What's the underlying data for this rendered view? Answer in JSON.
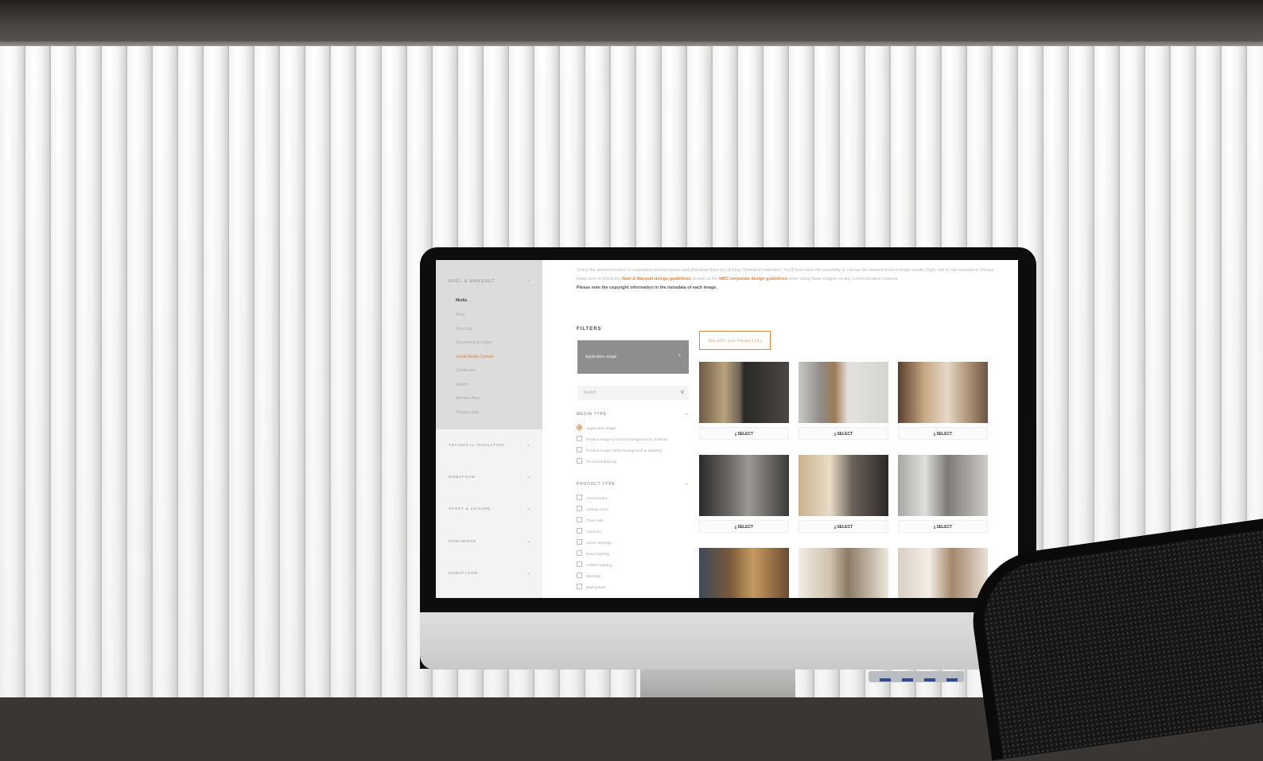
{
  "sidebar": {
    "brand": "NOËL & MARQUET",
    "items": [
      {
        "label": "Media",
        "state": "active"
      },
      {
        "label": "Shop",
        "state": "normal"
      },
      {
        "label": "Price List",
        "state": "normal"
      },
      {
        "label": "Documents & Logos",
        "state": "normal"
      },
      {
        "label": "Social Media Content",
        "state": "highlight"
      },
      {
        "label": "Certificates",
        "state": "normal"
      },
      {
        "label": "Search",
        "state": "normal"
      },
      {
        "label": "Member Area",
        "state": "normal"
      },
      {
        "label": "Private Label",
        "state": "normal"
      }
    ],
    "categories": [
      "TECHNICAL INSULATION",
      "NOMAFOAM",
      "SPORT & LEISURE",
      "NOMAWOOD",
      "NOMAFLOOR"
    ]
  },
  "intro": {
    "line1": "Select the desired product or inspiration pictures below and download them by clicking \"Download selection\". You'll then have the possibility to choose the desired level of image quality (high, mid or low resolution). Please make sure to follow the ",
    "link1": "Noël & Marquet design guidelines",
    "mid": " as well as the ",
    "link2": "NMC corporate design guidelines",
    "line2": " when using these images on any communication material.",
    "note": "Please note the copyright information in the metadata of each image."
  },
  "filters": {
    "title": "FILTERS",
    "active_chip": "Application image",
    "search_placeholder": "Search",
    "media_type_title": "MEDIA TYPE",
    "media_type_options": [
      {
        "label": "Application image",
        "checked": true
      },
      {
        "label": "Product image (coloured background & shadow)",
        "checked": false
      },
      {
        "label": "Product image (white background & shadow)",
        "checked": false
      },
      {
        "label": "Technical drawing",
        "checked": false
      }
    ],
    "product_type_title": "PRODUCT TYPE",
    "product_type_options": [
      "Accessories",
      "Ceiling roses",
      "Chair rails",
      "Cornices",
      "Cover skirtings",
      "Direct lighting",
      "Indirect lighting",
      "Skirtings",
      "Wall panels"
    ]
  },
  "gallery": {
    "select_all_label": "SELECT ALL FILES (12)",
    "select_label": "SELECT",
    "download_glyph": "⤓"
  },
  "colors": {
    "accent": "#e0853a",
    "sidebar_bg": "#f3f3f3",
    "filter_chip_bg": "#8e8e8e"
  },
  "icons": {
    "apple": "apple-logo-icon",
    "search": "search-icon",
    "chevron": "chevron-down-icon",
    "close": "close-icon"
  }
}
